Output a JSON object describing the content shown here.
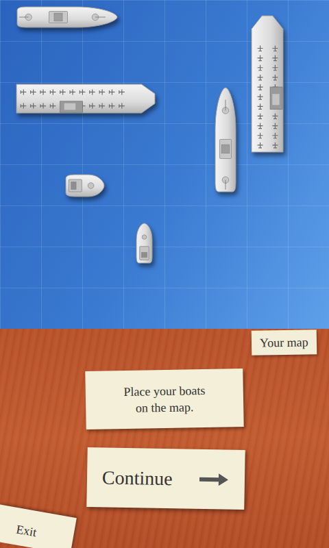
{
  "map": {
    "tab": "Your map",
    "boats": [
      {
        "kind": "battleship",
        "horizontal": true
      },
      {
        "kind": "carrier",
        "horizontal": true
      },
      {
        "kind": "patrol",
        "horizontal": true
      },
      {
        "kind": "patrol",
        "horizontal": false
      },
      {
        "kind": "battleship",
        "horizontal": false
      },
      {
        "kind": "carrier",
        "horizontal": false
      }
    ]
  },
  "instruction": {
    "lines": [
      "Place your boats",
      "on the map."
    ]
  },
  "continue_button": {
    "label": "Continue"
  },
  "exit_button": {
    "label": "Exit"
  }
}
